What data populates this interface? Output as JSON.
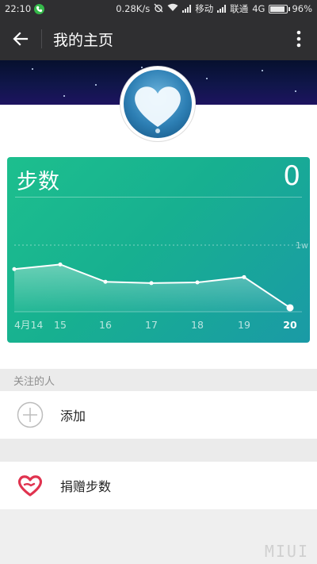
{
  "status_bar": {
    "time": "22:10",
    "speed": "0.28K/s",
    "carrier1": "移动",
    "carrier2": "联通",
    "network": "4G",
    "battery": "96%"
  },
  "app_bar": {
    "title": "我的主页"
  },
  "steps_card": {
    "title": "步数",
    "value": "0",
    "reference_label": "1w"
  },
  "chart_data": {
    "type": "area",
    "categories": [
      "4月14",
      "15",
      "16",
      "17",
      "18",
      "19",
      "20"
    ],
    "values": [
      6400,
      7100,
      4500,
      4300,
      4400,
      5200,
      600
    ],
    "ylim": [
      0,
      10000
    ],
    "reference_line": 10000
  },
  "following": {
    "header": "关注的人",
    "add_label": "添加"
  },
  "donate": {
    "label": "捐赠步数"
  },
  "colors": {
    "card_start": "#1dbf8e",
    "card_end": "#1a9aa6",
    "toolbar": "#2f2f31",
    "donate_icon": "#e0334f"
  }
}
